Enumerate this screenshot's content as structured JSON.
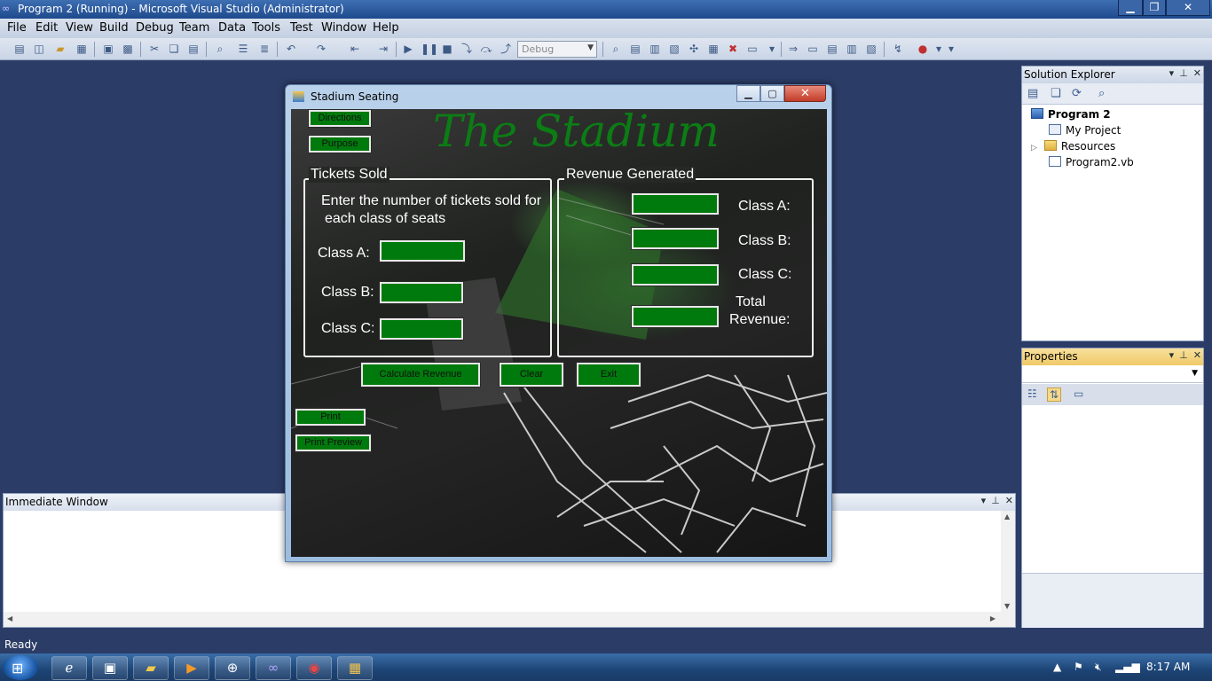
{
  "ide": {
    "title": "Program 2 (Running) - Microsoft Visual Studio (Administrator)",
    "menu": [
      "File",
      "Edit",
      "View",
      "Build",
      "Debug",
      "Team",
      "Data",
      "Tools",
      "Test",
      "Window",
      "Help"
    ],
    "toolbar": {
      "config": "Debug"
    },
    "solution_explorer": {
      "title": "Solution Explorer",
      "items": [
        {
          "label": "Program 2",
          "icon": "vb-project-icon"
        },
        {
          "label": "My Project",
          "icon": "my-project-icon"
        },
        {
          "label": "Resources",
          "icon": "folder-icon"
        },
        {
          "label": "Program2.vb",
          "icon": "vb-file-icon"
        }
      ]
    },
    "properties": {
      "title": "Properties"
    },
    "immediate": {
      "title": "Immediate Window"
    },
    "status": "Ready"
  },
  "taskbar": {
    "clock": "8:17 AM",
    "apps": [
      "ie-icon",
      "explorer-app-icon",
      "folder-icon",
      "media-player-icon",
      "hp-icon",
      "visual-studio-icon",
      "chrome-icon",
      "form-app-icon"
    ]
  },
  "form": {
    "window_title": "Stadium Seating",
    "heading": "The Stadium",
    "buttons": {
      "directions": "Directions",
      "purpose": "Purpose",
      "calculate": "Calculate Revenue",
      "clear": "Clear",
      "exit": "Exit",
      "print": "Print",
      "print_preview": "Print Preview"
    },
    "tickets": {
      "group_title": "Tickets Sold",
      "instruction_line1": "Enter the number of tickets sold for",
      "instruction_line2": "each class of seats",
      "class_a": "Class A:",
      "class_b": "Class B:",
      "class_c": "Class C:"
    },
    "revenue": {
      "group_title": "Revenue Generated",
      "class_a": "Class A:",
      "class_b": "Class B:",
      "class_c": "Class C:",
      "total_line1": "Total",
      "total_line2": "Revenue:"
    }
  }
}
